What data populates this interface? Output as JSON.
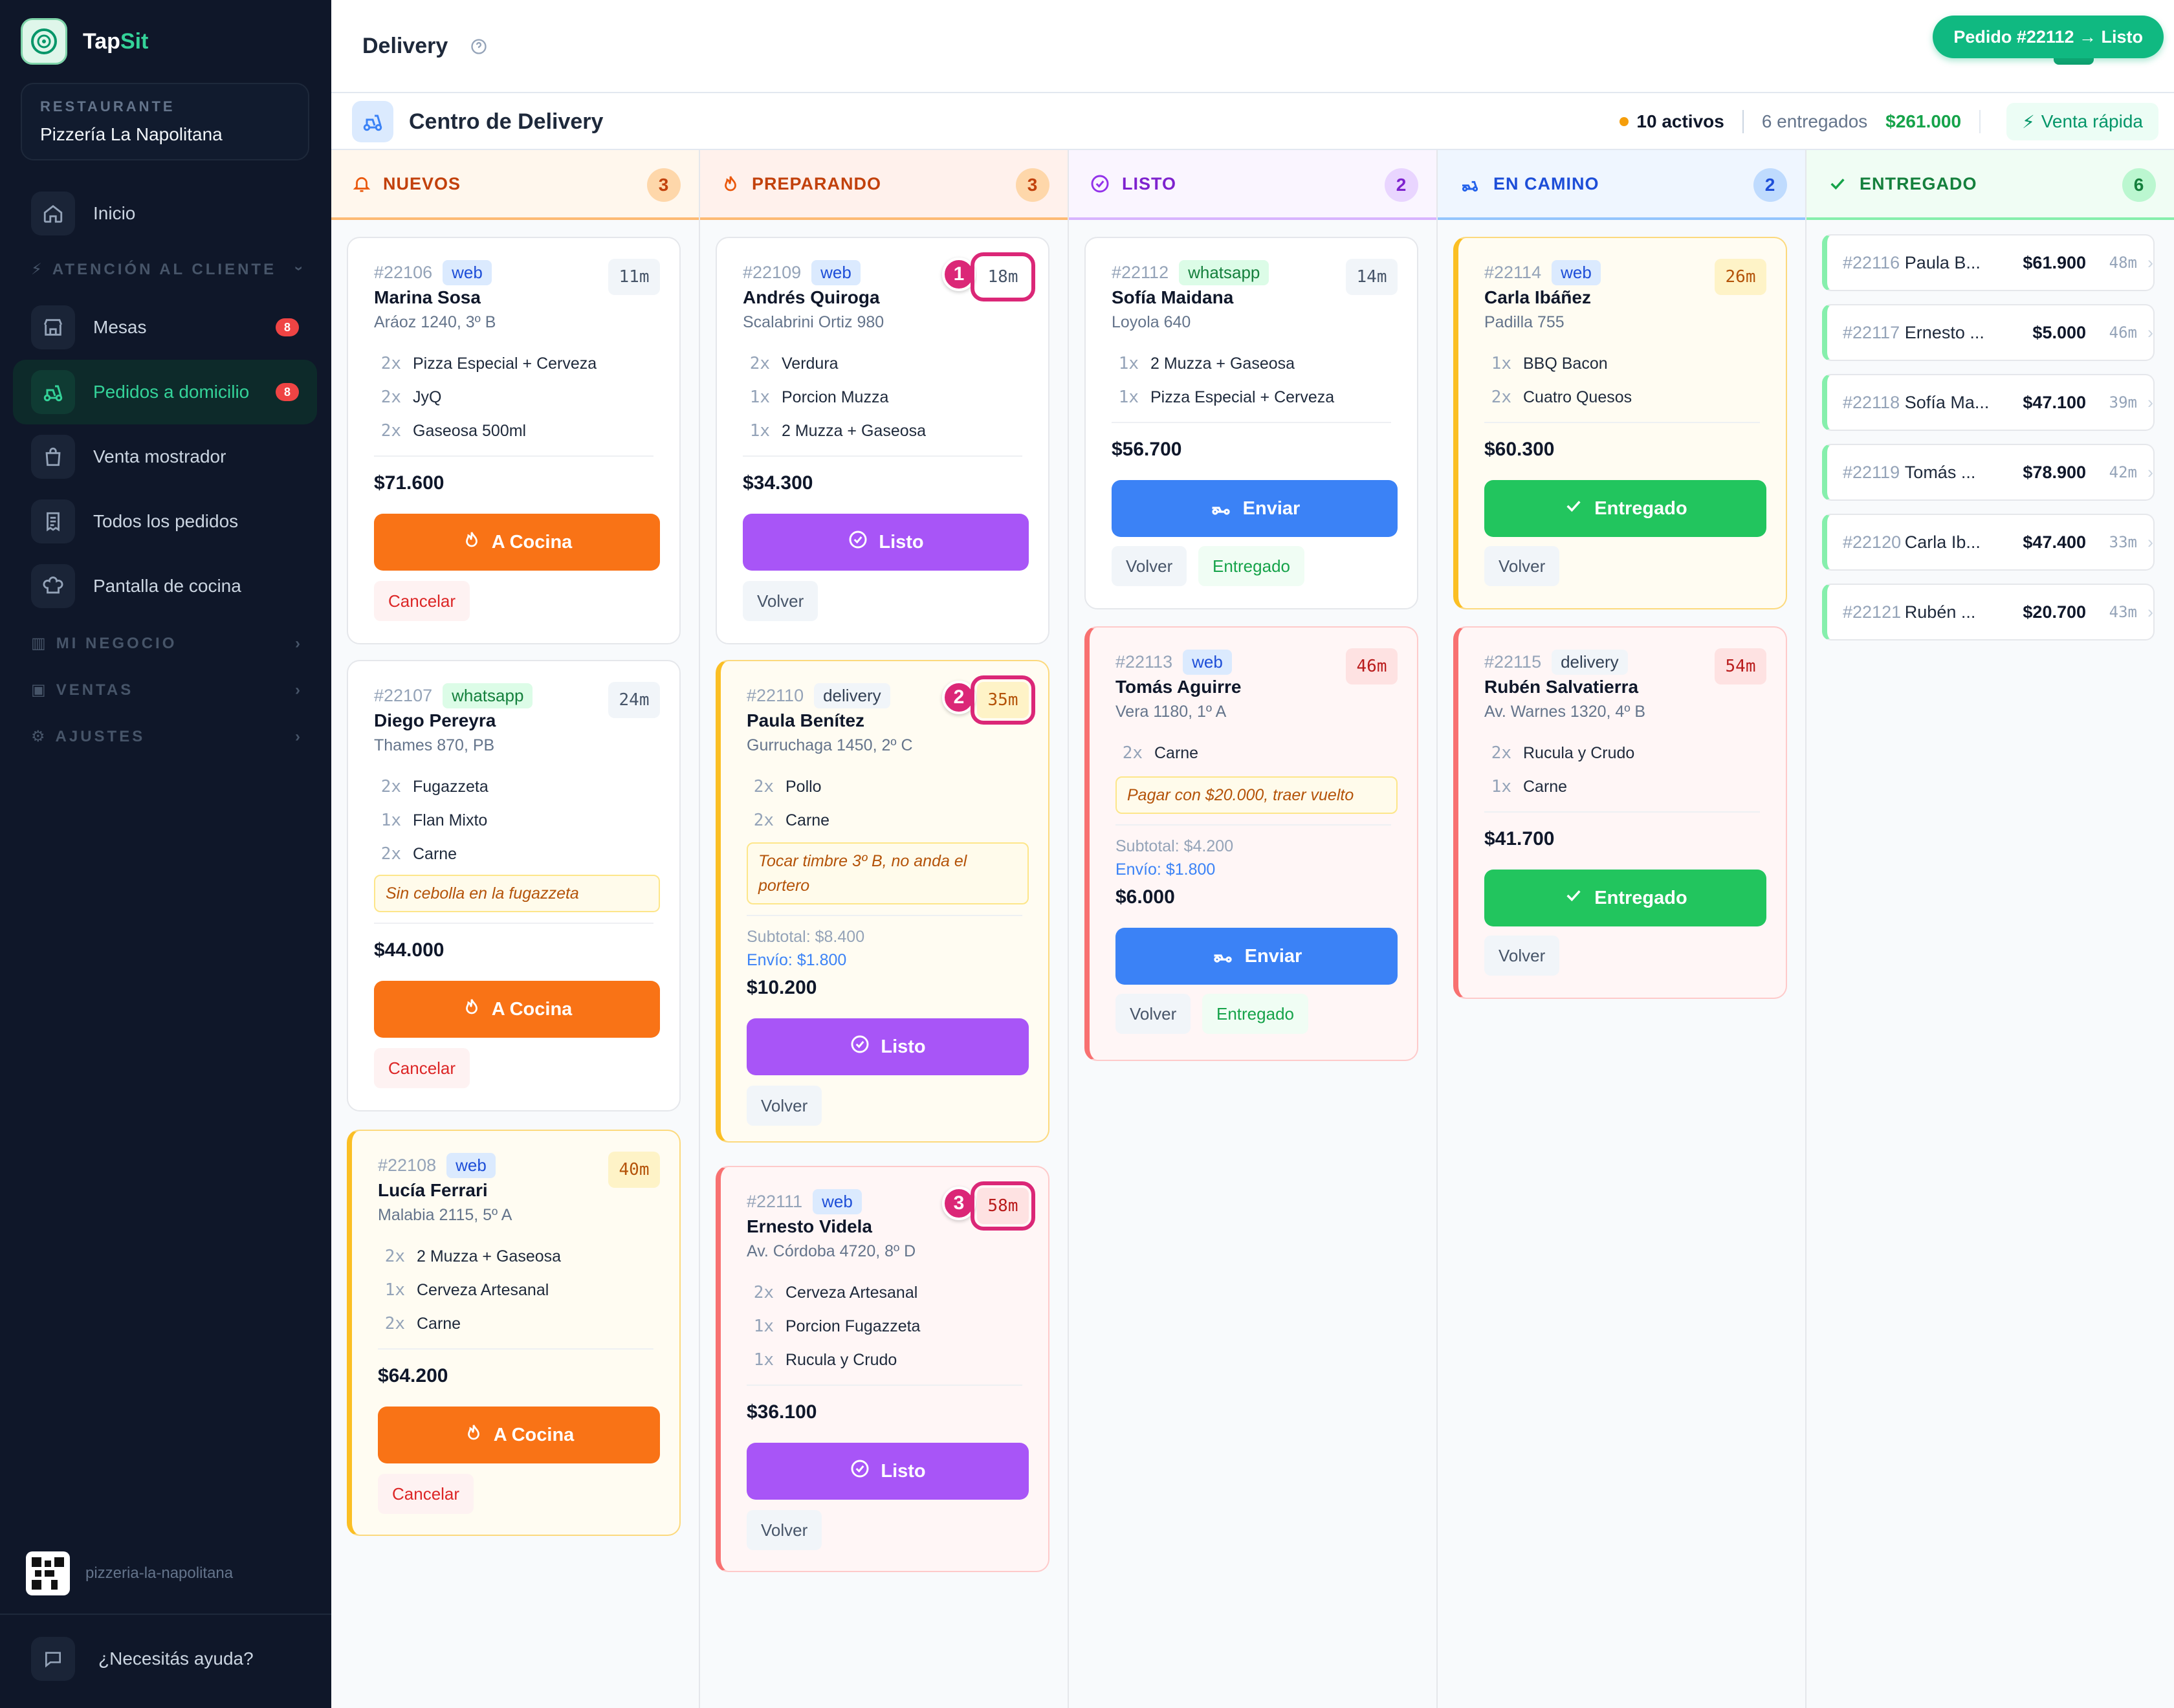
{
  "app": {
    "brand_a": "Tap",
    "brand_b": "Sit"
  },
  "sidebar": {
    "restaurant_label": "RESTAURANTE",
    "restaurant_name": "Pizzería La Napolitana",
    "inicio": "Inicio",
    "section_attention": "ATENCIÓN AL CLIENTE",
    "mesas": "Mesas",
    "mesas_badge": "8",
    "pedidos": "Pedidos a domicilio",
    "pedidos_badge": "8",
    "mostrador": "Venta mostrador",
    "todos": "Todos los pedidos",
    "cocina": "Pantalla de cocina",
    "section_negocio": "MI NEGOCIO",
    "section_ventas": "VENTAS",
    "section_ajustes": "AJUSTES",
    "slug": "pizzeria-la-napolitana",
    "help": "¿Necesitás ayuda?"
  },
  "header": {
    "title": "Delivery",
    "toast": "Pedido #22112 → Listo"
  },
  "subheader": {
    "title": "Centro de Delivery",
    "activos": "10 activos",
    "entregados": "6 entregados",
    "total": "$261.000",
    "quick": "Venta rápida"
  },
  "columns": {
    "nuevos": {
      "label": "NUEVOS",
      "count": "3"
    },
    "preparando": {
      "label": "PREPARANDO",
      "count": "3"
    },
    "listo": {
      "label": "LISTO",
      "count": "2"
    },
    "camino": {
      "label": "EN CAMINO",
      "count": "2"
    },
    "entregado": {
      "label": "ENTREGADO",
      "count": "6"
    }
  },
  "labels": {
    "a_cocina": "A Cocina",
    "cancelar": "Cancelar",
    "listo": "Listo",
    "volver": "Volver",
    "enviar": "Enviar",
    "entregado": "Entregado"
  },
  "markers": [
    "1",
    "2",
    "3"
  ],
  "orders": {
    "o22106": {
      "id": "#22106",
      "source": "web",
      "time": "11m",
      "name": "Marina Sosa",
      "addr": "Aráoz 1240, 3º B",
      "items": [
        {
          "q": "2x",
          "n": "Pizza Especial + Cerveza"
        },
        {
          "q": "2x",
          "n": "JyQ"
        },
        {
          "q": "2x",
          "n": "Gaseosa 500ml"
        }
      ],
      "total": "$71.600"
    },
    "o22107": {
      "id": "#22107",
      "source": "whatsapp",
      "time": "24m",
      "name": "Diego Pereyra",
      "addr": "Thames 870, PB",
      "items": [
        {
          "q": "2x",
          "n": "Fugazzeta"
        },
        {
          "q": "1x",
          "n": "Flan Mixto"
        },
        {
          "q": "2x",
          "n": "Carne"
        }
      ],
      "note": "Sin cebolla en la fugazzeta",
      "total": "$44.000"
    },
    "o22108": {
      "id": "#22108",
      "source": "web",
      "time": "40m",
      "name": "Lucía Ferrari",
      "addr": "Malabia 2115, 5º A",
      "items": [
        {
          "q": "2x",
          "n": "2 Muzza + Gaseosa"
        },
        {
          "q": "1x",
          "n": "Cerveza Artesanal"
        },
        {
          "q": "2x",
          "n": "Carne"
        }
      ],
      "total": "$64.200"
    },
    "o22109": {
      "id": "#22109",
      "source": "web",
      "time": "18m",
      "name": "Andrés Quiroga",
      "addr": "Scalabrini Ortiz 980",
      "items": [
        {
          "q": "2x",
          "n": "Verdura"
        },
        {
          "q": "1x",
          "n": "Porcion Muzza"
        },
        {
          "q": "1x",
          "n": "2 Muzza + Gaseosa"
        }
      ],
      "total": "$34.300"
    },
    "o22110": {
      "id": "#22110",
      "source": "delivery",
      "time": "35m",
      "name": "Paula Benítez",
      "addr": "Gurruchaga 1450, 2º C",
      "items": [
        {
          "q": "2x",
          "n": "Pollo"
        },
        {
          "q": "2x",
          "n": "Carne"
        }
      ],
      "note": "Tocar timbre 3º B, no anda el portero",
      "subtotal": "Subtotal: $8.400",
      "envio": "Envío: $1.800",
      "total": "$10.200"
    },
    "o22111": {
      "id": "#22111",
      "source": "web",
      "time": "58m",
      "name": "Ernesto Videla",
      "addr": "Av. Córdoba 4720, 8º D",
      "items": [
        {
          "q": "2x",
          "n": "Cerveza Artesanal"
        },
        {
          "q": "1x",
          "n": "Porcion Fugazzeta"
        },
        {
          "q": "1x",
          "n": "Rucula y Crudo"
        }
      ],
      "total": "$36.100"
    },
    "o22112": {
      "id": "#22112",
      "source": "whatsapp",
      "time": "14m",
      "name": "Sofía Maidana",
      "addr": "Loyola 640",
      "items": [
        {
          "q": "1x",
          "n": "2 Muzza + Gaseosa"
        },
        {
          "q": "1x",
          "n": "Pizza Especial + Cerveza"
        }
      ],
      "total": "$56.700"
    },
    "o22113": {
      "id": "#22113",
      "source": "web",
      "time": "46m",
      "name": "Tomás Aguirre",
      "addr": "Vera 1180, 1º A",
      "items": [
        {
          "q": "2x",
          "n": "Carne"
        }
      ],
      "note": "Pagar con $20.000, traer vuelto",
      "subtotal": "Subtotal: $4.200",
      "envio": "Envío: $1.800",
      "total": "$6.000"
    },
    "o22114": {
      "id": "#22114",
      "source": "web",
      "time": "26m",
      "name": "Carla Ibáñez",
      "addr": "Padilla 755",
      "items": [
        {
          "q": "1x",
          "n": "BBQ Bacon"
        },
        {
          "q": "2x",
          "n": "Cuatro Quesos"
        }
      ],
      "total": "$60.300"
    },
    "o22115": {
      "id": "#22115",
      "source": "delivery",
      "time": "54m",
      "name": "Rubén Salvatierra",
      "addr": "Av. Warnes 1320, 4º B",
      "items": [
        {
          "q": "2x",
          "n": "Rucula y Crudo"
        },
        {
          "q": "1x",
          "n": "Carne"
        }
      ],
      "total": "$41.700"
    }
  },
  "delivered": [
    {
      "id": "#22116",
      "name": "Paula B...",
      "amount": "$61.900",
      "time": "48m"
    },
    {
      "id": "#22117",
      "name": "Ernesto ...",
      "amount": "$5.000",
      "time": "46m"
    },
    {
      "id": "#22118",
      "name": "Sofía Ma...",
      "amount": "$47.100",
      "time": "39m"
    },
    {
      "id": "#22119",
      "name": "Tomás ...",
      "amount": "$78.900",
      "time": "42m"
    },
    {
      "id": "#22120",
      "name": "Carla Ib...",
      "amount": "$47.400",
      "time": "33m"
    },
    {
      "id": "#22121",
      "name": "Rubén ...",
      "amount": "$20.700",
      "time": "43m"
    }
  ]
}
